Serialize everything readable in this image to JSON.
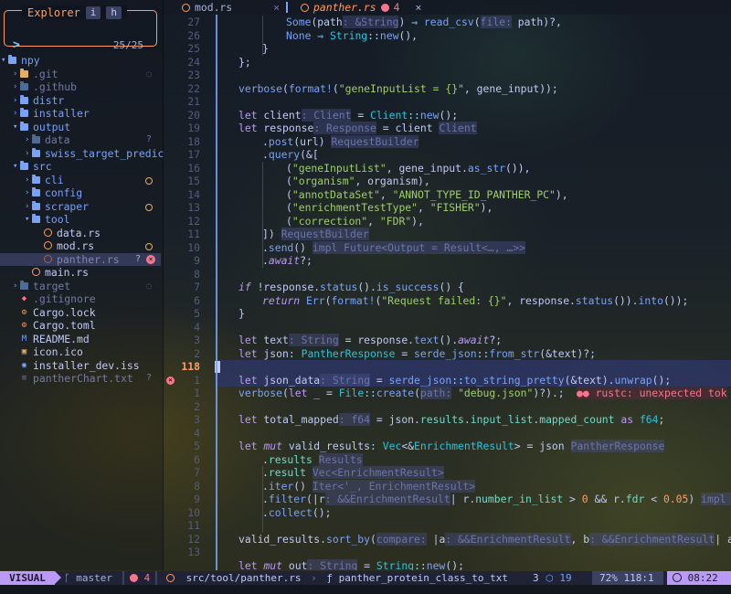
{
  "explorer": {
    "title": "Explorer",
    "key_i": "i",
    "key_h": "h",
    "prompt": ">",
    "count": "25/25"
  },
  "tree": [
    {
      "name": "npy",
      "kind": "folder-open",
      "depth": 0
    },
    {
      "name": ".git",
      "kind": "folder-git",
      "depth": 1,
      "mark": "eye-off"
    },
    {
      "name": ".github",
      "kind": "folder-dim",
      "depth": 1
    },
    {
      "name": "distr",
      "kind": "folder",
      "depth": 1
    },
    {
      "name": "installer",
      "kind": "folder",
      "depth": 1
    },
    {
      "name": "output",
      "kind": "folder-open",
      "depth": 1
    },
    {
      "name": "data",
      "kind": "folder-dim",
      "depth": 2,
      "mark": "?"
    },
    {
      "name": "swiss_target_predic",
      "kind": "folder",
      "depth": 2
    },
    {
      "name": "src",
      "kind": "folder-open",
      "depth": 1
    },
    {
      "name": "cli",
      "kind": "folder",
      "depth": 2,
      "mark": "o"
    },
    {
      "name": "config",
      "kind": "folder",
      "depth": 2
    },
    {
      "name": "scraper",
      "kind": "folder",
      "depth": 2,
      "mark": "o"
    },
    {
      "name": "tool",
      "kind": "folder-open",
      "depth": 2
    },
    {
      "name": "data.rs",
      "kind": "rust",
      "depth": 3
    },
    {
      "name": "mod.rs",
      "kind": "rust",
      "depth": 3,
      "mark": "o"
    },
    {
      "name": "panther.rs",
      "kind": "rust-dim",
      "depth": 3,
      "mark": "? err",
      "selected": true
    },
    {
      "name": "main.rs",
      "kind": "rust",
      "depth": 2
    },
    {
      "name": "target",
      "kind": "folder-dim",
      "depth": 1,
      "mark": "eye-off"
    },
    {
      "name": ".gitignore",
      "kind": "gitignore",
      "depth": 1
    },
    {
      "name": "Cargo.lock",
      "kind": "cargo",
      "depth": 1
    },
    {
      "name": "Cargo.toml",
      "kind": "cargo",
      "depth": 1
    },
    {
      "name": "README.md",
      "kind": "md",
      "depth": 1
    },
    {
      "name": "icon.ico",
      "kind": "ico",
      "depth": 1
    },
    {
      "name": "installer_dev.iss",
      "kind": "iss",
      "depth": 1
    },
    {
      "name": "pantherChart.txt",
      "kind": "txt",
      "depth": 1,
      "mark": "?"
    }
  ],
  "tabs": [
    {
      "name": "mod.rs",
      "active": false,
      "close": "×"
    },
    {
      "name": "panther.rs",
      "active": true,
      "errors": "4",
      "close": "×"
    }
  ],
  "editor": {
    "line_numbers": [
      "27",
      "26",
      "25",
      "24",
      "23",
      "22",
      "21",
      "20",
      "19",
      "18",
      "17",
      "16",
      "15",
      "14",
      "13",
      "12",
      "11",
      "10",
      "9",
      "8",
      "7",
      "6",
      "5",
      "4",
      "3",
      "2",
      "118",
      "1",
      "1",
      "2",
      "3",
      "4",
      "5",
      "6",
      "7",
      "8",
      "9",
      "10",
      "11",
      "12",
      "13"
    ],
    "current_line_index": 26,
    "error_line_index": 27,
    "diagnostic": "rustc: unexpected tok"
  },
  "status": {
    "mode": "VISUAL",
    "branch_icon": "ᚴ",
    "branch": "master",
    "errors": "4",
    "path": "src/tool/panther.rs",
    "symbol_icon": "ƒ",
    "symbol": "panther_protein_class_to_txt",
    "count_a": "3",
    "count_b": "19",
    "percent": "72%",
    "position": "118:1",
    "time": "08:22"
  },
  "colors": {
    "accent_orange": "#ff9e64",
    "visual_mode": "#bb9af7",
    "error": "#f7768e",
    "folder": "#7aa2f7"
  }
}
